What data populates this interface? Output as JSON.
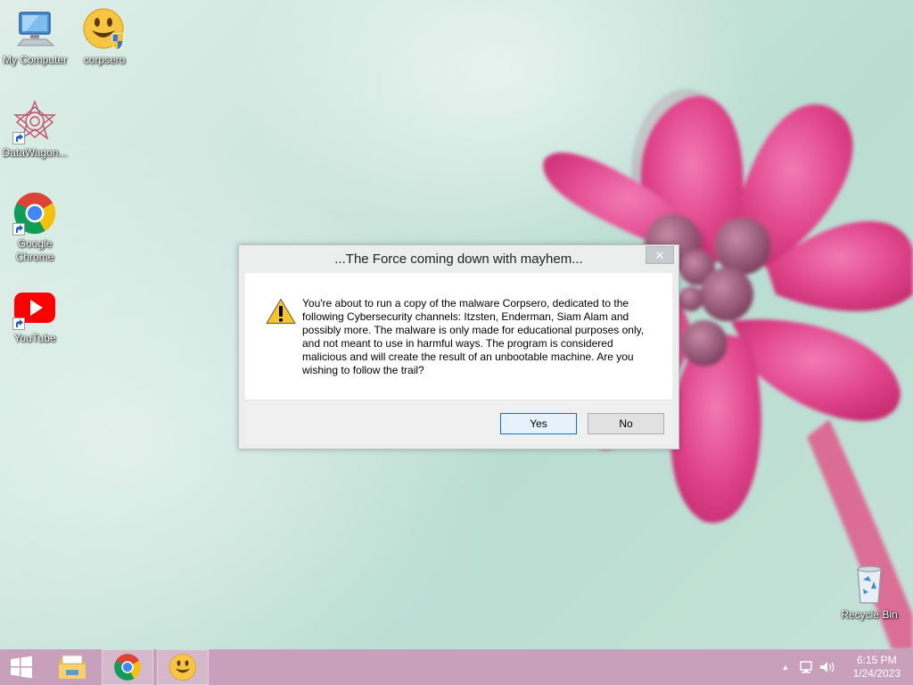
{
  "desktop": {
    "icons": [
      {
        "label": "My Computer",
        "icon": "computer-icon"
      },
      {
        "label": "corpsero",
        "icon": "smiley-shield-icon"
      },
      {
        "label": "DataWagon...",
        "icon": "datawagon-icon"
      },
      {
        "label": "Google Chrome",
        "icon": "chrome-icon"
      },
      {
        "label": "YouTube",
        "icon": "youtube-icon"
      },
      {
        "label": "Recycle Bin",
        "icon": "recycle-bin-icon"
      }
    ]
  },
  "dialog": {
    "title": "...The Force coming down with mayhem...",
    "close_label": "✕",
    "icon": "warning-icon",
    "message": "You're about to run a copy of the malware Corpsero, dedicated to the following Cybersecurity channels: Itzsten, Enderman, Siam Alam and possibly more. The malware is only made for educational purposes only, and not meant to use in harmful ways. The program is considered malicious and will create the result of an unbootable machine. Are you wishing to follow the trail?",
    "yes_label": "Yes",
    "no_label": "No"
  },
  "taskbar": {
    "start_icon": "windows-start-icon",
    "apps": [
      {
        "name": "File Explorer",
        "icon": "folder-icon"
      },
      {
        "name": "Google Chrome",
        "icon": "chrome-icon"
      },
      {
        "name": "corpsero",
        "icon": "smiley-icon"
      }
    ],
    "tray_icons": [
      "chevron-up-icon",
      "network-icon",
      "volume-icon"
    ],
    "time": "6:15 PM",
    "date": "1/24/2023"
  },
  "colors": {
    "taskbar": "#c9a0bb",
    "accent": "#0078d7",
    "flower": "#e0458c"
  }
}
